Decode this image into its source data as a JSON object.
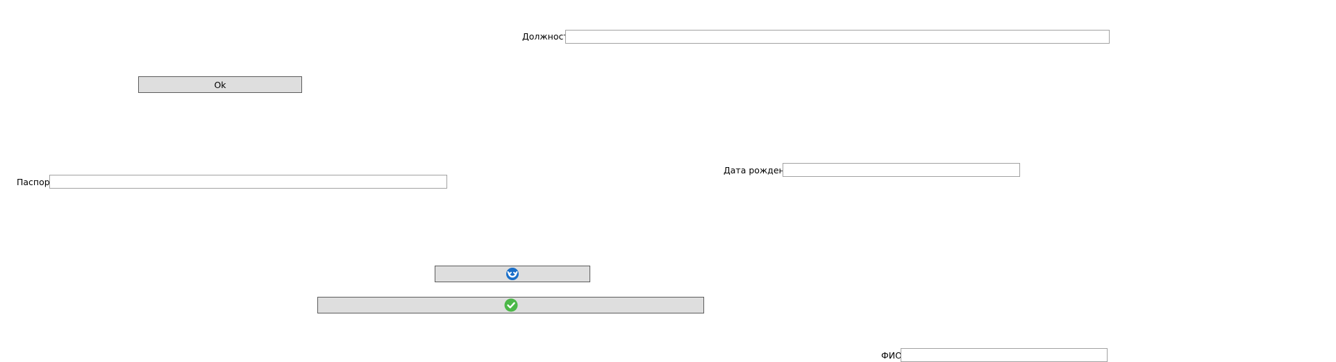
{
  "fields": {
    "position": {
      "label": "Должность",
      "value": ""
    },
    "passport": {
      "label": "Паспорт",
      "value": ""
    },
    "birth_date": {
      "label": "Дата рождения",
      "value": ""
    },
    "full_name": {
      "label": "ФИО",
      "value": ""
    }
  },
  "buttons": {
    "ok": {
      "label": "Ok"
    },
    "cancel": {
      "icon": "refresh-cancel-icon",
      "icon_color": "#1a6fc9"
    },
    "confirm": {
      "icon": "checkmark-icon",
      "icon_color": "#4cb848"
    }
  },
  "colors": {
    "button_bg": "#dedede",
    "input_border": "#a0a0a0"
  }
}
